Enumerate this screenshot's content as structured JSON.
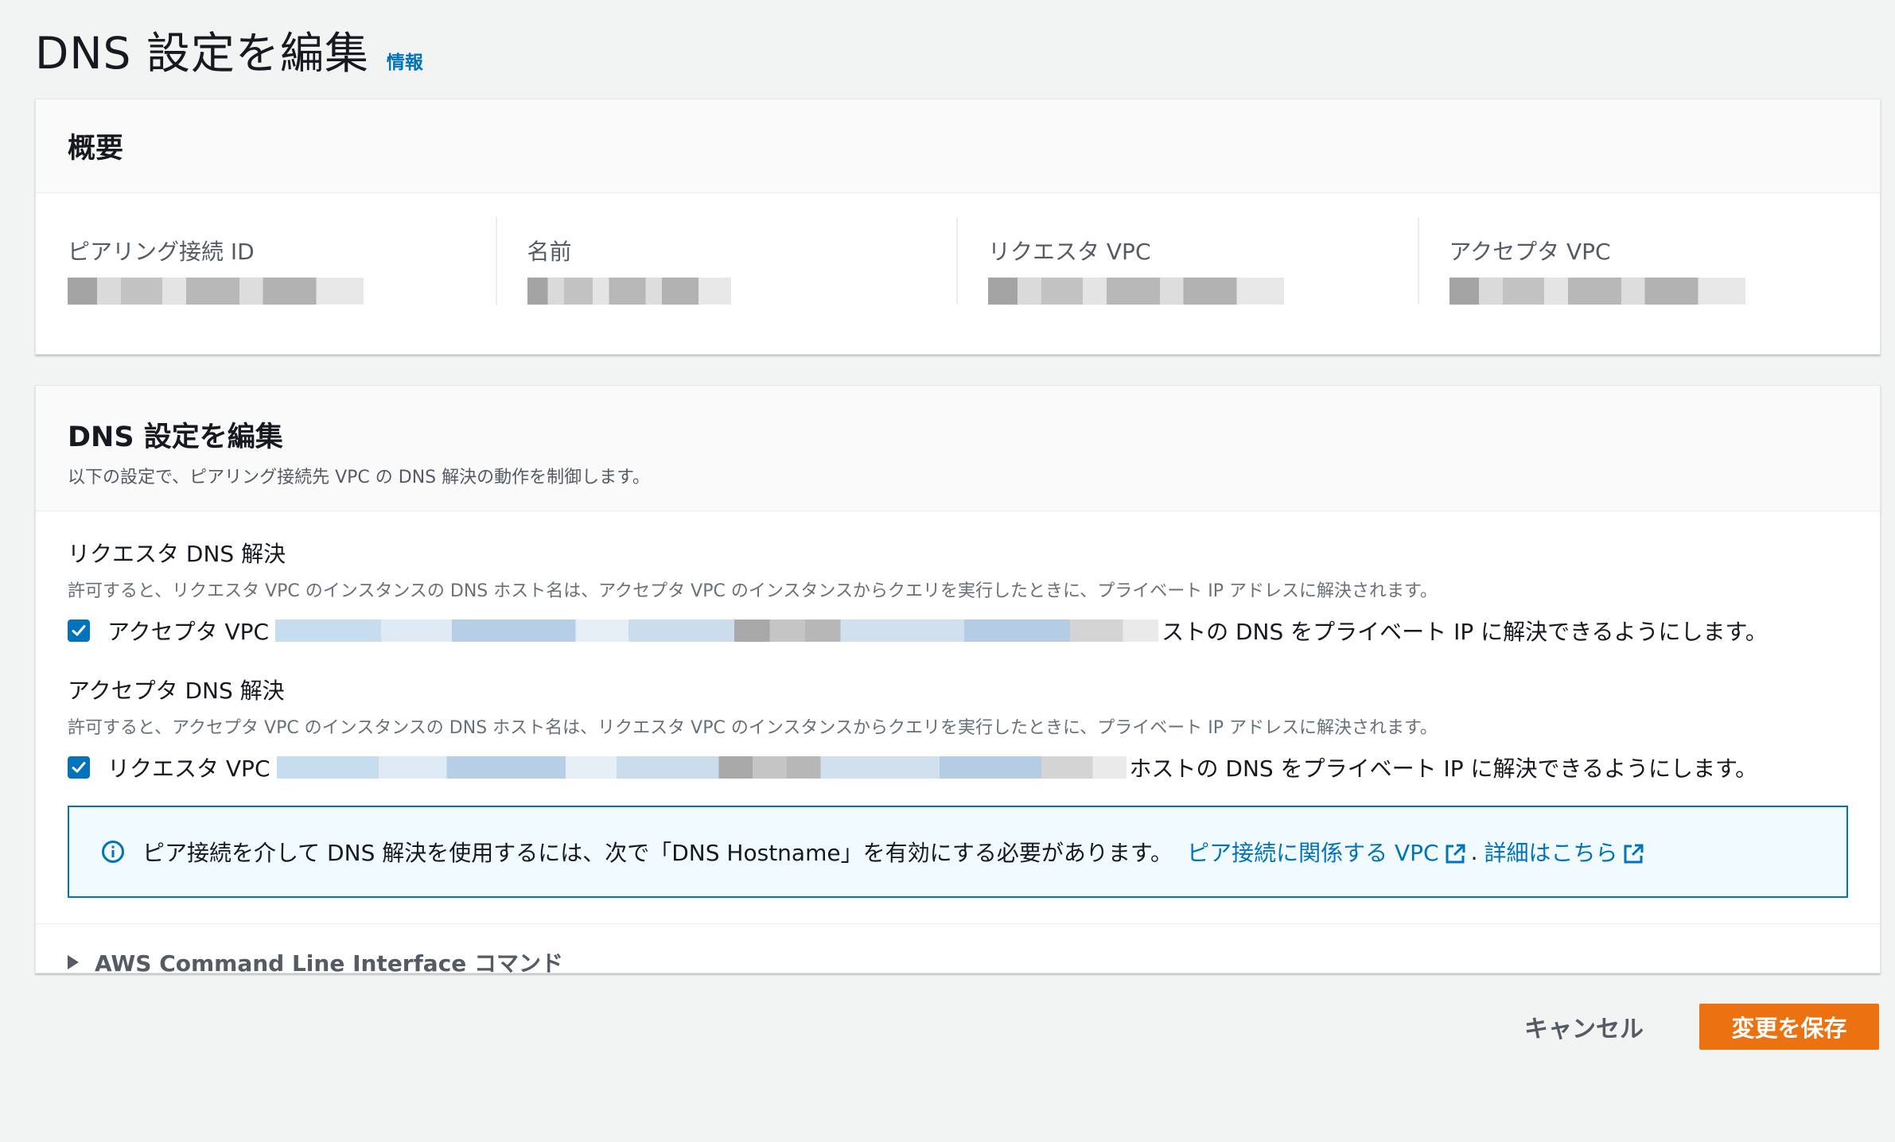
{
  "header": {
    "title": "DNS 設定を編集",
    "info_link": "情報"
  },
  "overview": {
    "title": "概要",
    "fields": [
      {
        "label": "ピアリング接続 ID"
      },
      {
        "label": "名前"
      },
      {
        "label": "リクエスタ VPC"
      },
      {
        "label": "アクセプタ VPC"
      }
    ]
  },
  "dns": {
    "title": "DNS 設定を編集",
    "description": "以下の設定で、ピアリング接続先 VPC の DNS 解決の動作を制御します。",
    "requester": {
      "title": "リクエスタ DNS 解決",
      "description": "許可すると、リクエスタ VPC のインスタンスの DNS ホスト名は、アクセプタ VPC のインスタンスからクエリを実行したときに、プライベート IP アドレスに解決されます。",
      "check_prefix": "アクセプタ VPC",
      "check_suffix": "ストの DNS をプライベート IP に解決できるようにします。",
      "checked": true
    },
    "accepter": {
      "title": "アクセプタ DNS 解決",
      "description": "許可すると、アクセプタ VPC のインスタンスの DNS ホスト名は、リクエスタ VPC のインスタンスからクエリを実行したときに、プライベート IP アドレスに解決されます。",
      "check_prefix": "リクエスタ VPC",
      "check_suffix": "ホストの DNS をプライベート IP に解決できるようにします。",
      "checked": true
    },
    "alert": {
      "text": "ピア接続を介して DNS 解決を使用するには、次で「DNS Hostname」を有効にする必要があります。",
      "link1": "ピア接続に関係する VPC",
      "separator": ".",
      "link2": "詳細はこちら"
    },
    "cli_label": "AWS Command Line Interface コマンド"
  },
  "actions": {
    "cancel": "キャンセル",
    "save": "変更を保存"
  },
  "colors": {
    "primary": "#ec7211",
    "link": "#0073bb",
    "alert_bg": "#f1faff"
  }
}
